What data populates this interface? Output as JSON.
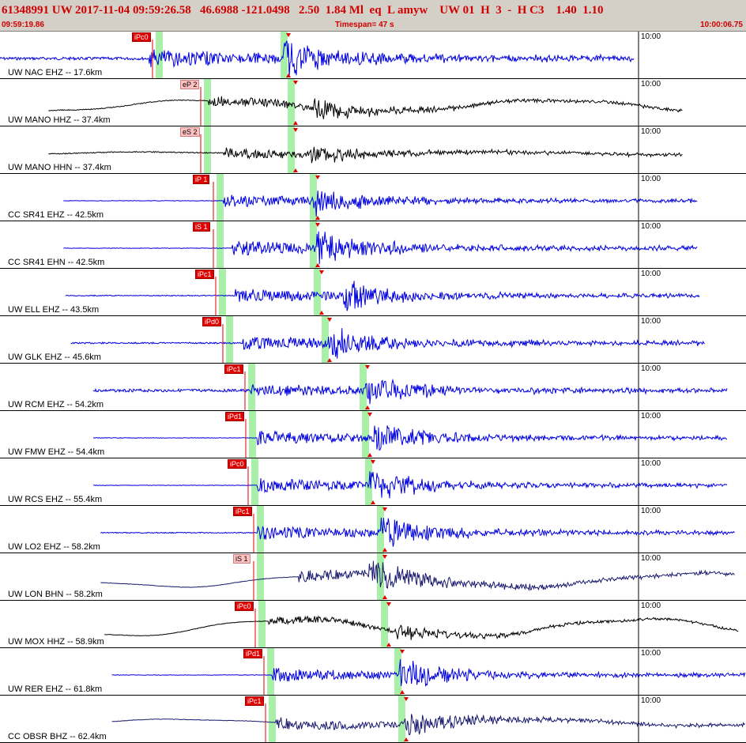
{
  "header": {
    "title_line": "61348991 UW 2017-11-04 09:59:26.58   46.6988 -121.0498   2.50  1.84 Ml  eq  L amyw    UW 01  H  3  -  H C3    1.40  1.10",
    "start_time": "09:59:19.86",
    "timespan": "Timespan=  47 s",
    "end_time": "10:00:06.75"
  },
  "colors": {
    "accent": "#d00000",
    "header_bg": "#d4d0c8",
    "trace_blue": "#0000e0",
    "trace_black": "#000000",
    "trace_navy": "#1a1a6e",
    "pick_bar": "#a8f0a8",
    "pick_red": "#e00000"
  },
  "traces": [
    {
      "station": "UW NAC EHZ -- 17.6km",
      "time_mark": "10:00",
      "pick": "iPc0",
      "pick_style": "solid",
      "color": "blue",
      "amp": 0.38,
      "noise": 0.06,
      "lp": 0,
      "p": 0.2,
      "s": 0.38,
      "start": 0.0,
      "end": 0.85,
      "bar1": 0.213,
      "bar2": 0.38
    },
    {
      "station": "UW MANO HHZ -- 37.4km",
      "time_mark": "10:00",
      "pick": "eP 2",
      "pick_style": "pale",
      "color": "black",
      "amp": 0.22,
      "noise": 0.02,
      "lp": 0.22,
      "p": 0.28,
      "s": 0.42,
      "start": 0.065,
      "end": 0.915,
      "bar1": 0.278,
      "bar2": 0.39
    },
    {
      "station": "UW MANO HHN -- 37.4km",
      "time_mark": "10:00",
      "pick": "eS 2",
      "pick_style": "pale",
      "color": "black",
      "amp": 0.22,
      "noise": 0.02,
      "lp": 0.05,
      "p": 0.3,
      "s": 0.415,
      "start": 0.065,
      "end": 0.915,
      "bar1": 0.278,
      "bar2": 0.39
    },
    {
      "station": "CC SR41 EHZ -- 42.5km",
      "time_mark": "10:00",
      "pick": "iP 1",
      "pick_style": "solid",
      "color": "blue",
      "amp": 0.28,
      "noise": 0.01,
      "lp": 0,
      "p": 0.3,
      "s": 0.42,
      "start": 0.085,
      "end": 0.935,
      "bar1": 0.294,
      "bar2": 0.419
    },
    {
      "station": "CC SR41 EHN -- 42.5km",
      "time_mark": "10:00",
      "pick": "iS 1",
      "pick_style": "solid",
      "color": "blue",
      "amp": 0.33,
      "noise": 0.01,
      "lp": 0,
      "p": 0.31,
      "s": 0.425,
      "start": 0.085,
      "end": 0.935,
      "bar1": 0.294,
      "bar2": 0.419
    },
    {
      "station": "UW ELL EHZ -- 43.5km",
      "time_mark": "10:00",
      "pick": "iPc1",
      "pick_style": "solid",
      "color": "blue",
      "amp": 0.3,
      "noise": 0.02,
      "lp": 0,
      "p": 0.315,
      "s": 0.46,
      "start": 0.088,
      "end": 0.938,
      "bar1": 0.298,
      "bar2": 0.425
    },
    {
      "station": "UW GLK EHZ -- 45.6km",
      "time_mark": "10:00",
      "pick": "iPd0",
      "pick_style": "solid",
      "color": "blue",
      "amp": 0.3,
      "noise": 0.03,
      "lp": 0,
      "p": 0.325,
      "s": 0.44,
      "start": 0.095,
      "end": 0.945,
      "bar1": 0.307,
      "bar2": 0.435
    },
    {
      "station": "UW RCM EHZ -- 54.2km",
      "time_mark": "10:00",
      "pick": "iPc1",
      "pick_style": "solid",
      "color": "blue",
      "amp": 0.26,
      "noise": 0.06,
      "lp": 0,
      "p": 0.335,
      "s": 0.49,
      "start": 0.125,
      "end": 0.975,
      "bar1": 0.337,
      "bar2": 0.486
    },
    {
      "station": "UW FMW EHZ -- 54.4km",
      "time_mark": "10:00",
      "pick": "iPd1",
      "pick_style": "solid",
      "color": "blue",
      "amp": 0.3,
      "noise": 0.01,
      "lp": 0,
      "p": 0.345,
      "s": 0.5,
      "start": 0.125,
      "end": 0.975,
      "bar1": 0.338,
      "bar2": 0.489
    },
    {
      "station": "UW RCS EHZ -- 55.4km",
      "time_mark": "10:00",
      "pick": "iPc0",
      "pick_style": "solid",
      "color": "blue",
      "amp": 0.3,
      "noise": 0.01,
      "lp": 0,
      "p": 0.345,
      "s": 0.495,
      "start": 0.125,
      "end": 0.975,
      "bar1": 0.341,
      "bar2": 0.494
    },
    {
      "station": "UW LO2 EHZ -- 58.2km",
      "time_mark": "10:00",
      "pick": "iPc1",
      "pick_style": "solid",
      "color": "blue",
      "amp": 0.3,
      "noise": 0.02,
      "lp": 0,
      "p": 0.345,
      "s": 0.51,
      "start": 0.135,
      "end": 0.985,
      "bar1": 0.349,
      "bar2": 0.51
    },
    {
      "station": "UW LON BHN -- 58.2km",
      "time_mark": "10:00",
      "pick": "iS 1",
      "pick_style": "pale",
      "color": "navy",
      "amp": 0.28,
      "noise": 0.01,
      "lp": 0.25,
      "p": 0.4,
      "s": 0.495,
      "start": 0.135,
      "end": 0.985,
      "bar1": 0.349,
      "bar2": 0.51
    },
    {
      "station": "UW MOX HHZ -- 58.9km",
      "time_mark": "10:00",
      "pick": "iPc0",
      "pick_style": "solid",
      "color": "black",
      "amp": 0.18,
      "noise": 0.01,
      "lp": 0.32,
      "p": 0.36,
      "s": 0.53,
      "start": 0.14,
      "end": 0.99,
      "bar1": 0.351,
      "bar2": 0.515
    },
    {
      "station": "UW RER EHZ -- 61.8km",
      "time_mark": "10:00",
      "pick": "iPd1",
      "pick_style": "solid",
      "color": "blue",
      "amp": 0.3,
      "noise": 0.01,
      "lp": 0,
      "p": 0.365,
      "s": 0.535,
      "start": 0.15,
      "end": 1.0,
      "bar1": 0.362,
      "bar2": 0.533
    },
    {
      "station": "CC OBSR BHZ -- 62.4km",
      "time_mark": "10:00",
      "pick": "iPc1",
      "pick_style": "solid",
      "color": "navy",
      "amp": 0.26,
      "noise": 0.01,
      "lp": 0.12,
      "p": 0.37,
      "s": 0.54,
      "start": 0.15,
      "end": 1.0,
      "bar1": 0.364,
      "bar2": 0.538
    }
  ]
}
